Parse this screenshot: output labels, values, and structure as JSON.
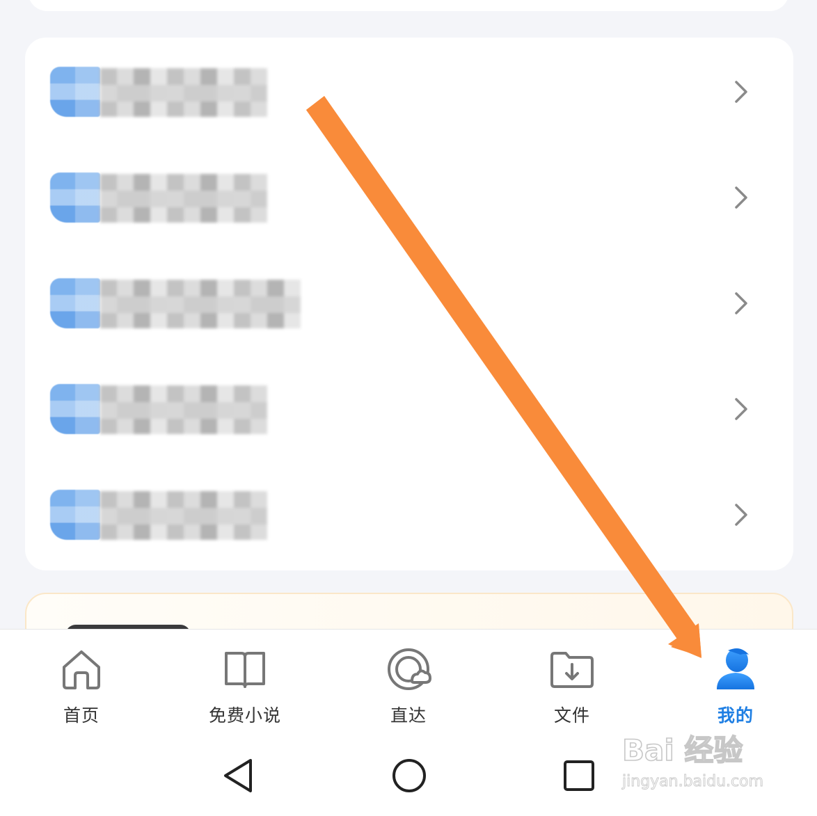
{
  "menu_rows": [
    {
      "redacted": true
    },
    {
      "redacted": true
    },
    {
      "redacted": true
    },
    {
      "redacted": true
    },
    {
      "redacted": true
    }
  ],
  "tab_bar": {
    "tabs": [
      {
        "label": "首页",
        "icon": "home-icon",
        "active": false
      },
      {
        "label": "免费小说",
        "icon": "book-icon",
        "active": false
      },
      {
        "label": "直达",
        "icon": "direct-icon",
        "active": false
      },
      {
        "label": "文件",
        "icon": "folder-download-icon",
        "active": false
      },
      {
        "label": "我的",
        "icon": "user-icon",
        "active": true
      }
    ]
  },
  "system_nav": {
    "icons": [
      "back-triangle-icon",
      "home-circle-icon",
      "recents-square-icon"
    ]
  },
  "watermark": {
    "brand": "Bai 经验",
    "url": "jingyan.baidu.com"
  },
  "colors": {
    "accent": "#1f7fe3",
    "annotation_arrow": "#f98b3a",
    "page_background": "#f4f5f9"
  }
}
